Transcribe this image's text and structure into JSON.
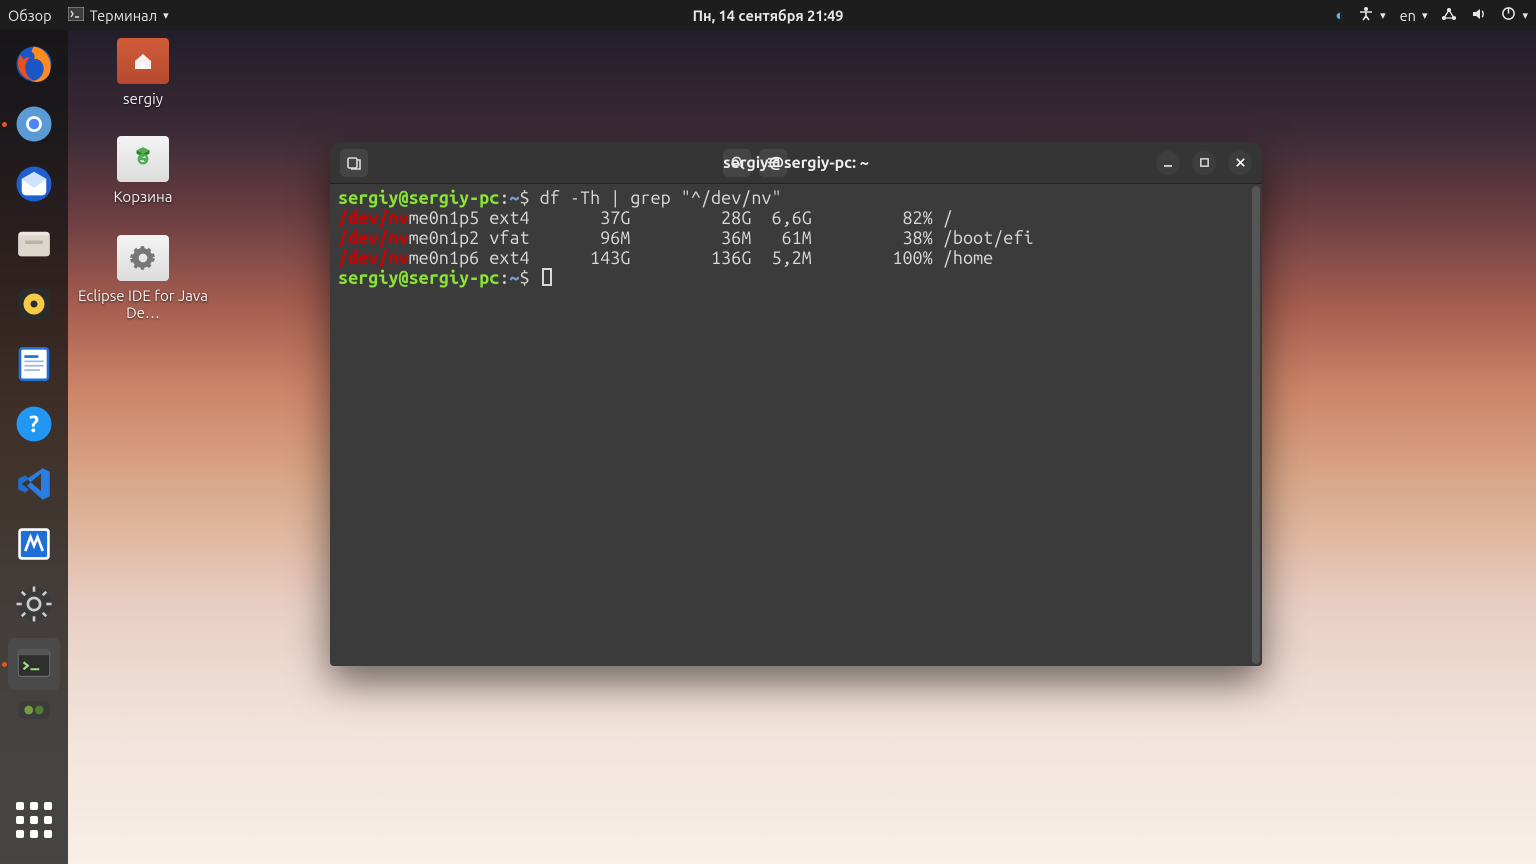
{
  "topbar": {
    "overview": "Обзор",
    "app_menu": "Терминал",
    "datetime": "Пн, 14 сентября  21:49",
    "lang": "en"
  },
  "desktop_icons": {
    "home": {
      "label": "sergiy"
    },
    "trash": {
      "label": "Корзина"
    },
    "eclipse": {
      "label": "Eclipse IDE for Java De…"
    }
  },
  "terminal": {
    "title": "sergiy@sergiy-pc: ~",
    "ps_user": "sergiy",
    "ps_at": "@",
    "ps_host": "sergiy-pc",
    "ps_colon": ":",
    "ps_path": "~",
    "ps_dollar": "$ ",
    "command": "df -Th | grep \"^/dev/nv\"",
    "hl": "/dev/nv",
    "rows": [
      {
        "rest": "me0n1p5 ext4       37G         28G  6,6G         82% /"
      },
      {
        "rest": "me0n1p2 vfat       96M         36M   61M         38% /boot/efi"
      },
      {
        "rest": "me0n1p6 ext4      143G        136G  5,2M        100% /home"
      }
    ]
  }
}
